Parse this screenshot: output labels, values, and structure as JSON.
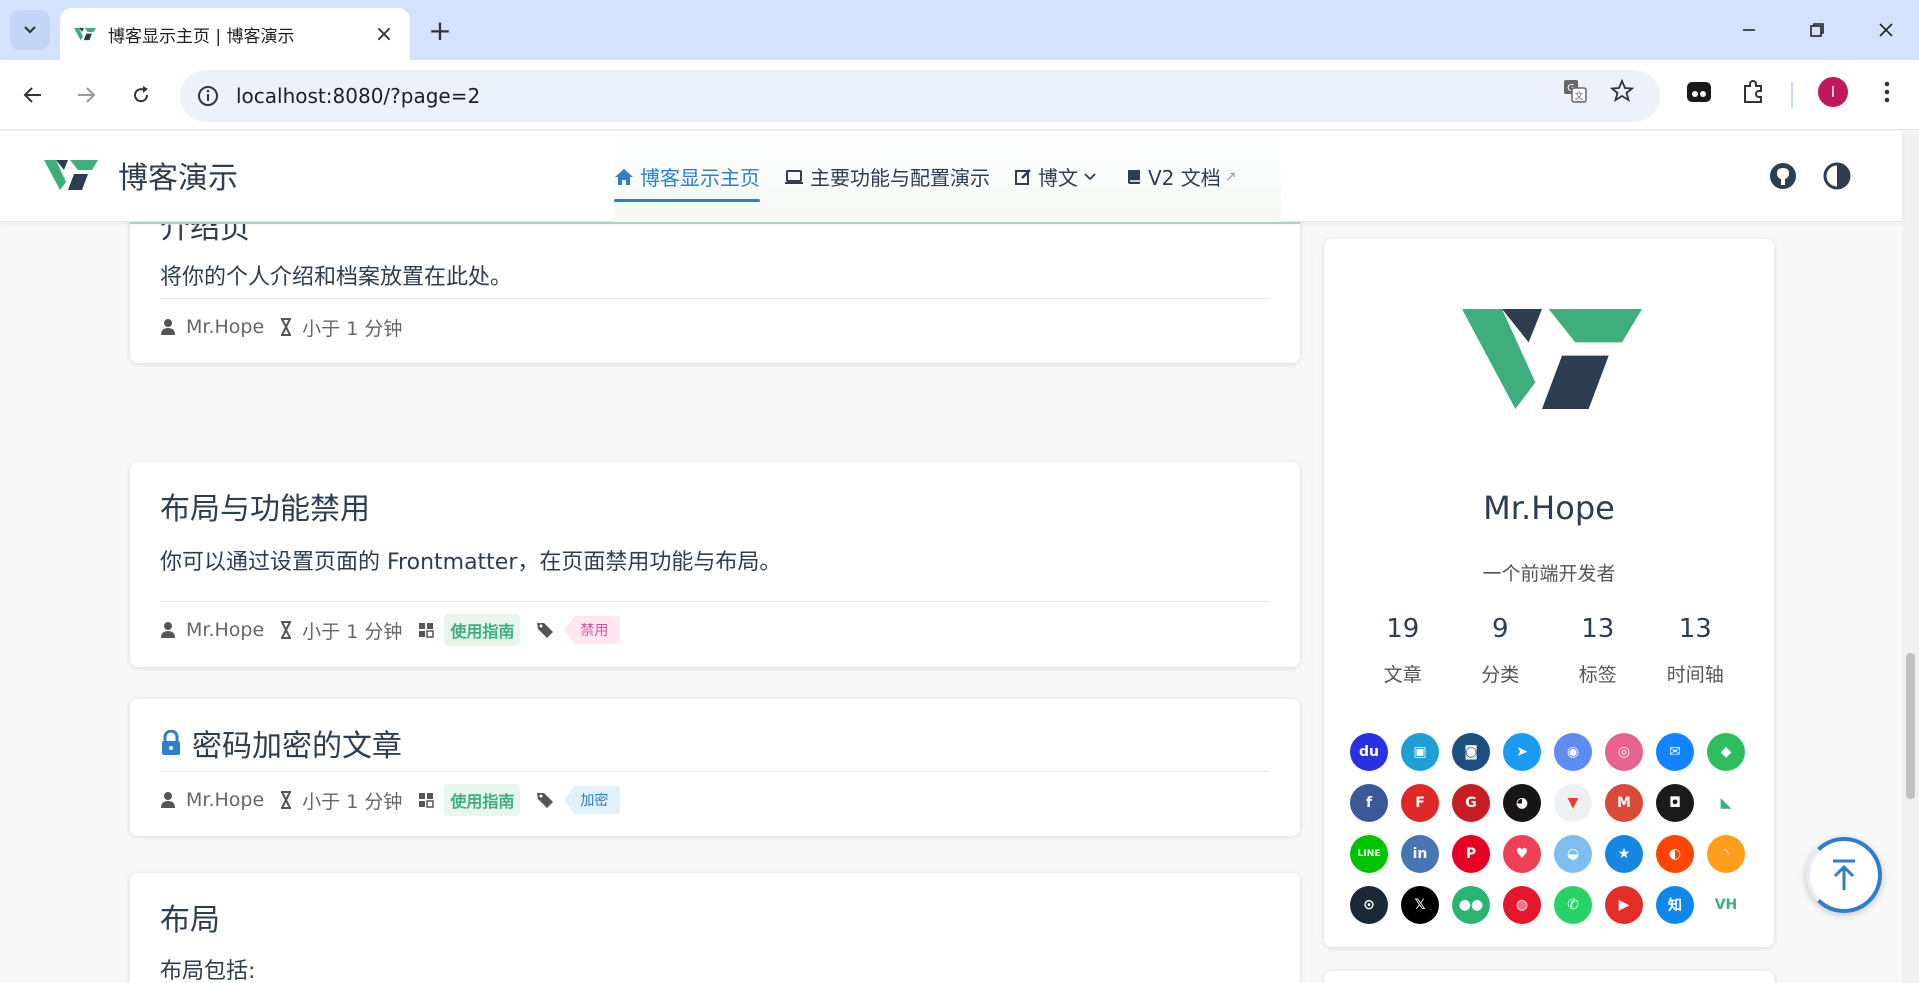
{
  "browser": {
    "tab_title": "博客显示主页 | 博客演示",
    "url": "localhost:8080/?page=2",
    "profile_initial": "I"
  },
  "site": {
    "brand": "博客演示",
    "nav": [
      {
        "label": "博客显示主页",
        "icon": "home-icon"
      },
      {
        "label": "主要功能与配置演示",
        "icon": "laptop-icon"
      },
      {
        "label": "博文",
        "icon": "edit-icon"
      },
      {
        "label": "V2 文档",
        "icon": "book-icon",
        "external": "↗"
      }
    ]
  },
  "articles": [
    {
      "title": "介绍页",
      "excerpt": "将你的个人介绍和档案放置在此处。",
      "author": "Mr.Hope",
      "reading_time": "小于 1 分钟"
    },
    {
      "title": "布局与功能禁用",
      "excerpt": "你可以通过设置页面的 Frontmatter，在页面禁用功能与布局。",
      "author": "Mr.Hope",
      "reading_time": "小于 1 分钟",
      "category": "使用指南",
      "tag": "禁用"
    },
    {
      "title": "密码加密的文章",
      "author": "Mr.Hope",
      "reading_time": "小于 1 分钟",
      "category": "使用指南",
      "tag": "加密"
    },
    {
      "title": "布局",
      "excerpt": "布局包括:"
    }
  ],
  "profile": {
    "name": "Mr.Hope",
    "description": "一个前端开发者",
    "stats": [
      {
        "value": "19",
        "label": "文章"
      },
      {
        "value": "9",
        "label": "分类"
      },
      {
        "value": "13",
        "label": "标签"
      },
      {
        "value": "13",
        "label": "时间轴"
      }
    ],
    "socials": [
      {
        "name": "baidu-icon",
        "color": "#2932e1",
        "glyph": "du"
      },
      {
        "name": "bilibili-icon",
        "color": "#1e9fd6",
        "glyph": "▣"
      },
      {
        "name": "bitbucket-icon",
        "color": "#1d4f7e",
        "glyph": "◙"
      },
      {
        "name": "dingding-icon",
        "color": "#1a9bf0",
        "glyph": "➤"
      },
      {
        "name": "discord-icon",
        "color": "#5d8df0",
        "glyph": "◉"
      },
      {
        "name": "dribbble-icon",
        "color": "#e7628f",
        "glyph": "◎"
      },
      {
        "name": "email-icon",
        "color": "#1384ff",
        "glyph": "✉"
      },
      {
        "name": "evernote-icon",
        "color": "#2dbe60",
        "glyph": "◆"
      },
      {
        "name": "facebook-icon",
        "color": "#3b5998",
        "glyph": "f"
      },
      {
        "name": "flipboard-icon",
        "color": "#e12828",
        "glyph": "F"
      },
      {
        "name": "gitee-icon",
        "color": "#c71d23",
        "glyph": "G"
      },
      {
        "name": "github-icon",
        "color": "#171515",
        "glyph": "◕"
      },
      {
        "name": "gitlab-icon",
        "color": "#eef0f4",
        "glyph": "▼"
      },
      {
        "name": "gmail-icon",
        "color": "#da4a3a",
        "glyph": "M"
      },
      {
        "name": "instagram-icon",
        "color": "#1a1a1a",
        "glyph": "◘"
      },
      {
        "name": "lark-icon",
        "color": "#ffffff",
        "glyph": "◣"
      },
      {
        "name": "line-icon",
        "color": "#00c300",
        "glyph": "LINE"
      },
      {
        "name": "linkedin-icon",
        "color": "#4875b4",
        "glyph": "in"
      },
      {
        "name": "pinterest-icon",
        "color": "#e60023",
        "glyph": "P"
      },
      {
        "name": "pocket-icon",
        "color": "#ef4056",
        "glyph": "♥"
      },
      {
        "name": "qq-icon",
        "color": "#7dbdef",
        "glyph": "◒"
      },
      {
        "name": "qzone-icon",
        "color": "#1688e3",
        "glyph": "★"
      },
      {
        "name": "reddit-icon",
        "color": "#ff4500",
        "glyph": "◐"
      },
      {
        "name": "rss-icon",
        "color": "#ff9e1b",
        "glyph": "◝"
      },
      {
        "name": "steam-icon",
        "color": "#1b2838",
        "glyph": "⊙"
      },
      {
        "name": "x-icon",
        "color": "#000000",
        "glyph": "𝕏"
      },
      {
        "name": "wechat-icon",
        "color": "#29b56f",
        "glyph": "●●"
      },
      {
        "name": "weibo-icon",
        "color": "#e6162d",
        "glyph": "◍"
      },
      {
        "name": "whatsapp-icon",
        "color": "#25d366",
        "glyph": "✆"
      },
      {
        "name": "youtube-icon",
        "color": "#e52d27",
        "glyph": "▶"
      },
      {
        "name": "zhihu-icon",
        "color": "#0f88eb",
        "glyph": "知"
      },
      {
        "name": "vuepress-hope-icon",
        "color": "#ffffff",
        "glyph": "VH"
      }
    ]
  }
}
